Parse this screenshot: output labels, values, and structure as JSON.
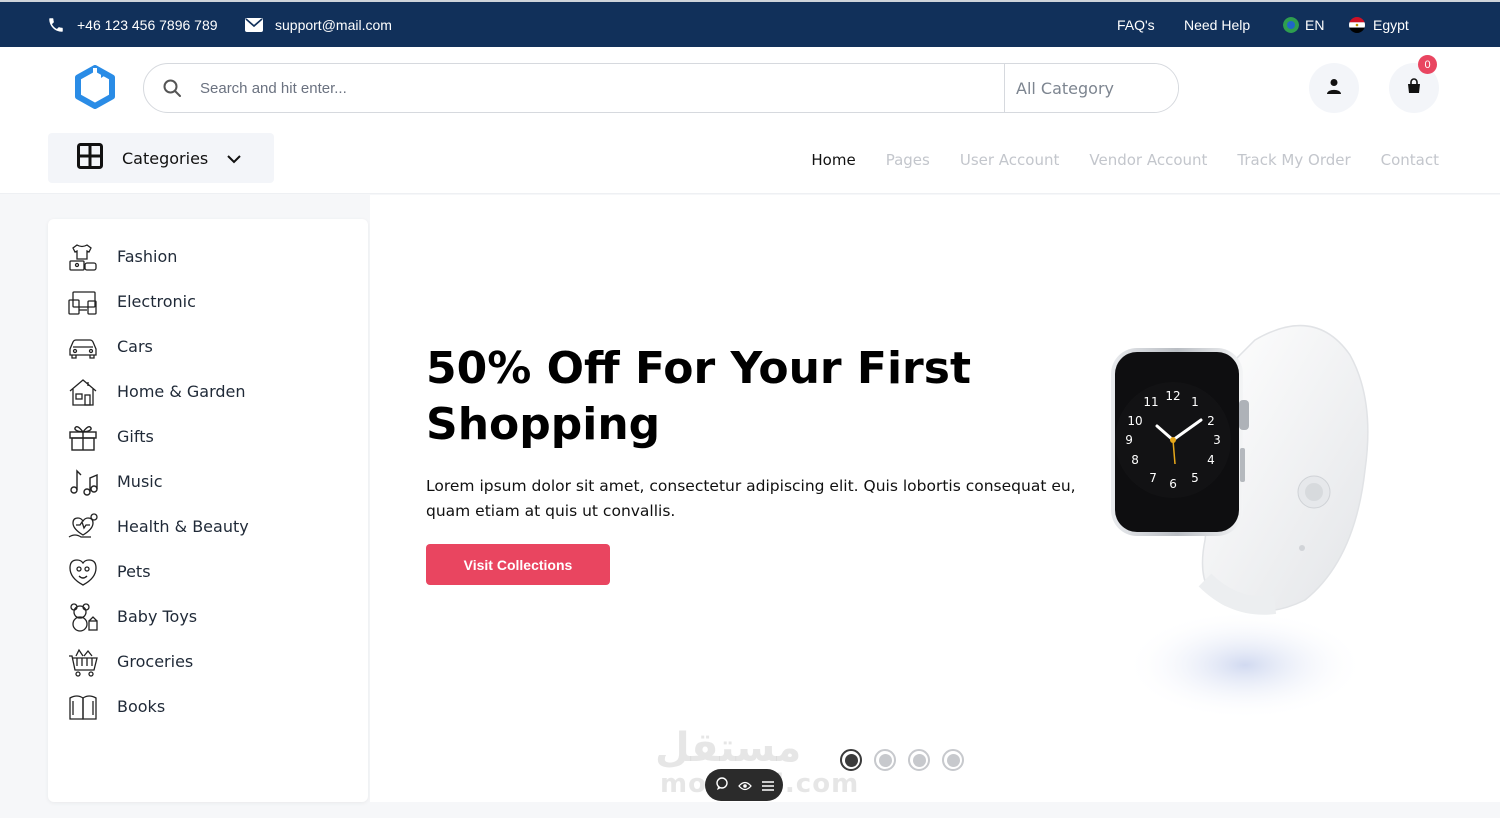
{
  "topbar": {
    "phone": "+46 123 456 7896 789",
    "email": "support@mail.com",
    "faq": "FAQ's",
    "help": "Need Help",
    "language": "EN",
    "country": "Egypt",
    "icons": {
      "phone": "phone-icon",
      "email": "mail-icon",
      "language": "globe-flag-icon",
      "country": "egypt-flag-icon"
    }
  },
  "header": {
    "search_placeholder": "Search and hit enter...",
    "category_select": "All Category",
    "cart_count": "0",
    "categories_button": "Categories"
  },
  "nav": {
    "items": [
      "Home",
      "Pages",
      "User Account",
      "Vendor Account",
      "Track My Order",
      "Contact"
    ],
    "active": "Home"
  },
  "sidebar": {
    "items": [
      {
        "label": "Fashion",
        "icon": "fashion-icon"
      },
      {
        "label": "Electronic",
        "icon": "electronic-icon"
      },
      {
        "label": "Cars",
        "icon": "car-icon"
      },
      {
        "label": "Home & Garden",
        "icon": "home-icon"
      },
      {
        "label": "Gifts",
        "icon": "gift-icon"
      },
      {
        "label": "Music",
        "icon": "music-icon"
      },
      {
        "label": "Health & Beauty",
        "icon": "health-icon"
      },
      {
        "label": "Pets",
        "icon": "pets-icon"
      },
      {
        "label": "Baby Toys",
        "icon": "toy-icon"
      },
      {
        "label": "Groceries",
        "icon": "basket-icon"
      },
      {
        "label": "Books",
        "icon": "book-icon"
      }
    ]
  },
  "hero": {
    "title": "50% Off For Your First Shopping",
    "description": "Lorem ipsum dolor sit amet, consectetur adipiscing elit. Quis lobortis consequat eu, quam etiam at quis ut convallis.",
    "cta": "Visit Collections",
    "slides": 4,
    "active_slide": 1
  },
  "watermark": {
    "text": "مستقل",
    "domain": "mostaql.com"
  },
  "colors": {
    "topbar": "#11305a",
    "accent": "#e94560",
    "logo": "#2a8ce6"
  }
}
